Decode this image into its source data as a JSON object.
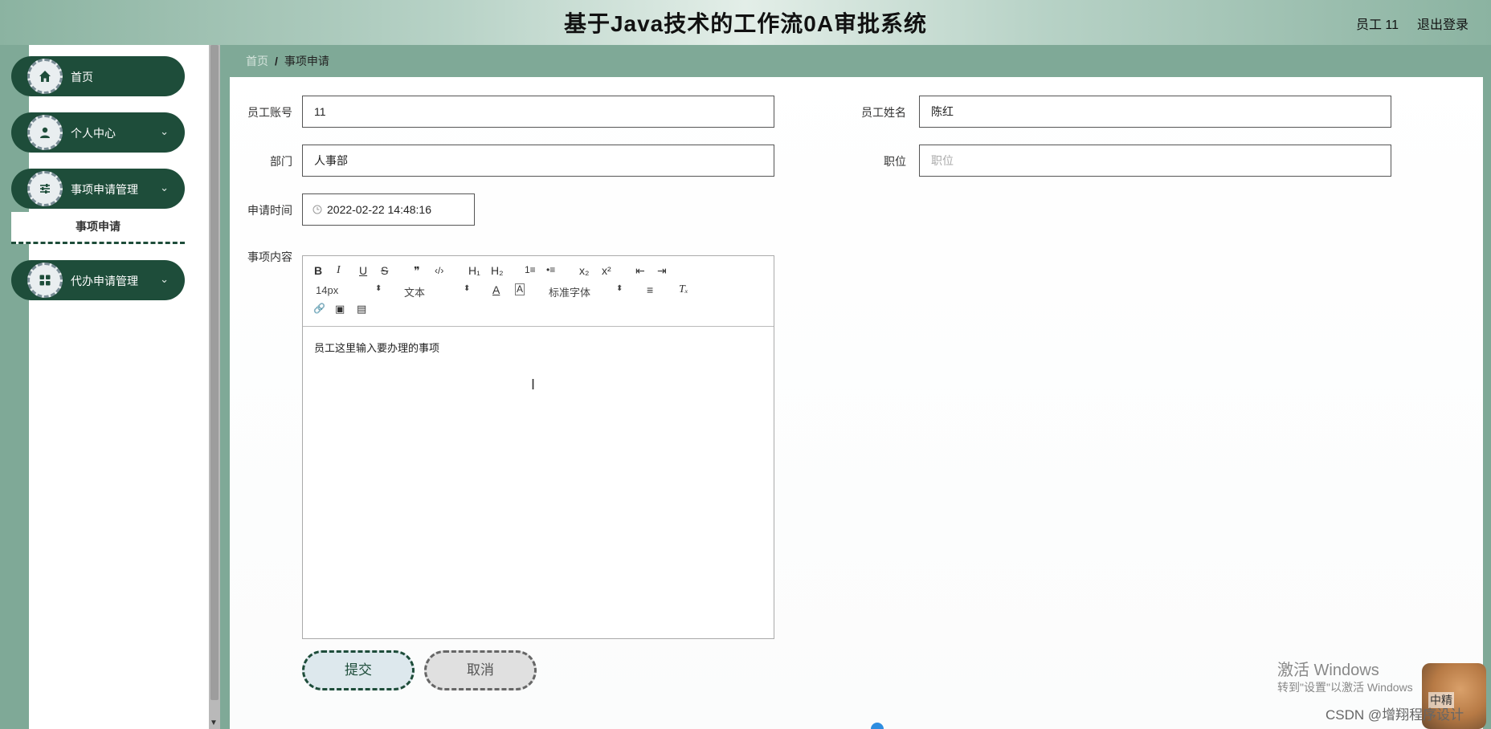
{
  "header": {
    "title": "基于Java技术的工作流0A审批系统",
    "user": "员工 11",
    "logout": "退出登录"
  },
  "sidebar": {
    "items": [
      {
        "label": "首页",
        "icon": "home-icon",
        "has_children": false
      },
      {
        "label": "个人中心",
        "icon": "user-icon",
        "has_children": true
      },
      {
        "label": "事项申请管理",
        "icon": "sliders-icon",
        "has_children": true
      },
      {
        "label": "代办申请管理",
        "icon": "grid-icon",
        "has_children": true
      }
    ],
    "submenu": {
      "label": "事项申请"
    },
    "chevron": "⌄"
  },
  "breadcrumb": {
    "home": "首页",
    "separator": "/",
    "current": "事项申请"
  },
  "form": {
    "account_label": "员工账号",
    "account_value": "11",
    "name_label": "员工姓名",
    "name_value": "陈红",
    "dept_label": "部门",
    "dept_value": "人事部",
    "position_label": "职位",
    "position_placeholder": "职位",
    "time_label": "申请时间",
    "time_value": "2022-02-22 14:48:16",
    "content_label": "事项内容",
    "content_value": "员工这里输入要办理的事项"
  },
  "editor_toolbar": {
    "bold": "B",
    "italic": "I",
    "underline": "U",
    "strike": "S",
    "quote": "❞",
    "code": "‹/›",
    "h1": "H₁",
    "h2": "H₂",
    "ol": "1≡",
    "ul": "•≡",
    "sub": "x₂",
    "sup": "x²",
    "outdent": "⇤",
    "indent": "⇥",
    "size_select": "14px",
    "header_select": "文本",
    "font_select": "标准字体",
    "select_arrow": "⬍",
    "color": "A",
    "background": "A",
    "align": "≡",
    "clean": "Tₓ",
    "link": "🔗",
    "image": "▣",
    "video": "▤"
  },
  "buttons": {
    "submit": "提交",
    "cancel": "取消"
  },
  "overlay": {
    "activate_title": "激活 Windows",
    "activate_sub": "转到\"设置\"以激活 Windows",
    "csdn": "CSDN @增翔程序设计",
    "dog_tag": "中精"
  },
  "colors": {
    "accent": "#1e4d3a",
    "page_bg": "#7fa997"
  }
}
